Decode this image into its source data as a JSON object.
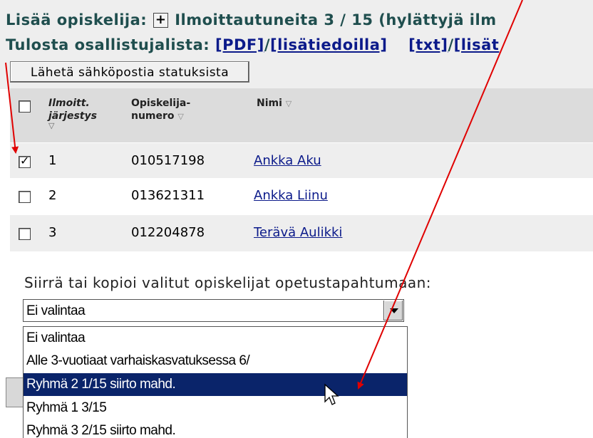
{
  "header": {
    "add_student_label": "Lisää opiskelija:",
    "plus_symbol": "+",
    "registered_text": "Ilmoittautuneita 3 / 15 (hylättyjä ilm",
    "print_label": "Tulosta osallistujalista:",
    "slash": "/",
    "link_pdf": "[PDF]",
    "link_lisatiedoilla": "[lisätiedoilla]",
    "link_txt": "[txt]",
    "link_lisat": "[lisät",
    "email_button": "Lähetä sähköpostia statuksista"
  },
  "table": {
    "col_order_line1": "Ilmoitt.",
    "col_order_line2": "järjestys",
    "col_studentno_line1": "Opiskelija-",
    "col_studentno_line2": "numero",
    "col_name": "Nimi",
    "rows": [
      {
        "checked": true,
        "order": "1",
        "student_number": "010517198",
        "name": "Ankka Aku"
      },
      {
        "checked": false,
        "order": "2",
        "student_number": "013621311",
        "name": "Ankka Liinu"
      },
      {
        "checked": false,
        "order": "3",
        "student_number": "012204878",
        "name": "Terävä Aulikki"
      }
    ]
  },
  "move": {
    "label": "Siirrä tai kopioi valitut opiskelijat opetustapahtumaan:",
    "selected_value": "Ei valintaa",
    "options": [
      "Ei valintaa",
      "Alle 3-vuotiaat varhaiskasvatuksessa 6/",
      "Ryhmä 2 1/15 siirto mahd.",
      "Ryhmä 1 3/15",
      "Ryhmä 3 2/15 siirto mahd."
    ],
    "highlighted_index": 2
  },
  "colors": {
    "annotation_arrow": "#e00000",
    "highlight": "#0a246a",
    "link": "#0b1a8a"
  }
}
